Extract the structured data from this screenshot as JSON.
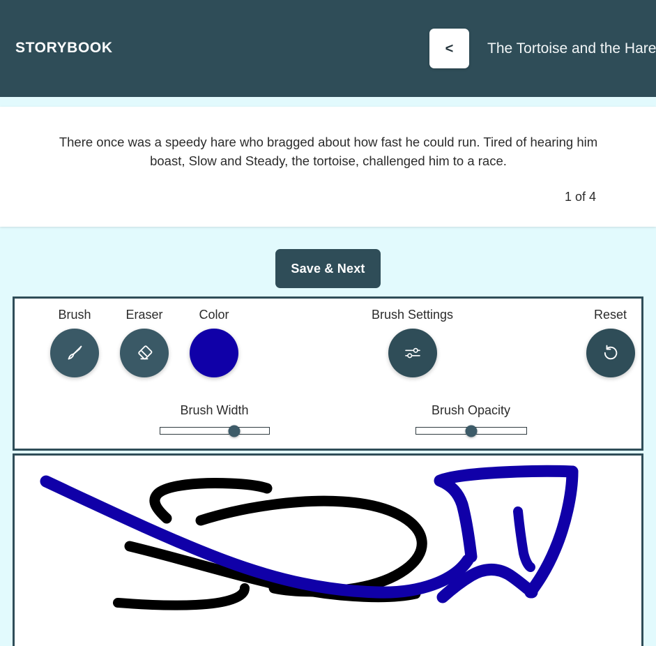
{
  "header": {
    "brand": "STORYBOOK",
    "back_label": "<",
    "story_title": "The Tortoise and the Hare",
    "bg_color": "#2f4d58"
  },
  "story": {
    "text": "There once was a speedy hare who bragged about how fast he could run. Tired of hearing him boast, Slow and Steady, the tortoise, challenged him to a race.",
    "page_counter": "1 of 4",
    "current_page": 1,
    "total_pages": 4
  },
  "actions": {
    "save_next_label": "Save & Next"
  },
  "toolbar": {
    "tools": [
      {
        "label": "Brush",
        "icon": "paintbrush-icon",
        "active": true
      },
      {
        "label": "Eraser",
        "icon": "eraser-icon",
        "active": false
      },
      {
        "label": "Color",
        "icon": "color-swatch",
        "color": "#1000a8"
      },
      {
        "label": "Brush Settings",
        "icon": "sliders-icon",
        "active": false
      },
      {
        "label": "Reset",
        "icon": "rotate-ccw-icon",
        "active": false
      }
    ],
    "sliders": [
      {
        "label": "Brush Width",
        "value_percent": 68
      },
      {
        "label": "Brush Opacity",
        "value_percent": 50
      }
    ]
  },
  "canvas": {
    "stroke_colors": [
      "#1000a8",
      "#000000"
    ],
    "background": "#ffffff"
  },
  "colors": {
    "page_bg": "#e2fafd",
    "accent_dark": "#2f4d58",
    "brush_blue": "#1000a8",
    "brush_black": "#000000"
  }
}
